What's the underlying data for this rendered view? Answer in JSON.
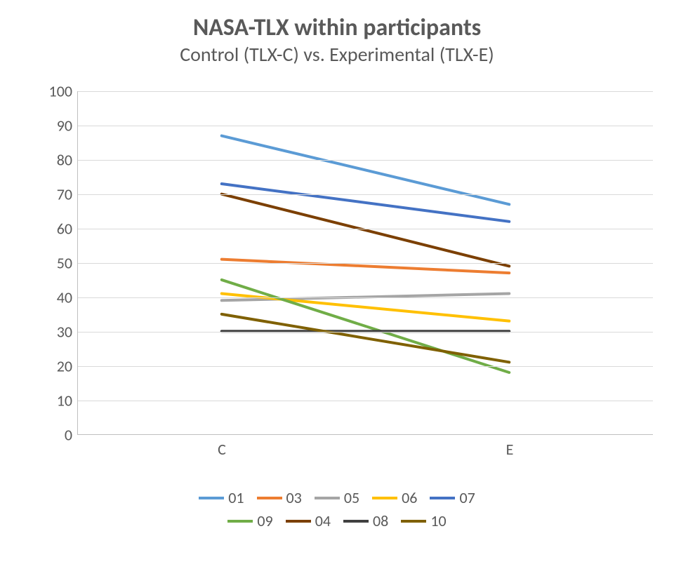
{
  "chart_data": {
    "type": "line",
    "title": "NASA-TLX within participants",
    "subtitle": "Control (TLX-C) vs. Experimental (TLX-E)",
    "xlabel": "",
    "ylabel": "",
    "categories": [
      "C",
      "E"
    ],
    "ylim": [
      0,
      100
    ],
    "yticks": [
      0,
      10,
      20,
      30,
      40,
      50,
      60,
      70,
      80,
      90,
      100
    ],
    "legend_order": [
      "01",
      "03",
      "05",
      "06",
      "07",
      "09",
      "04",
      "08",
      "10"
    ],
    "series": [
      {
        "name": "01",
        "values": [
          87,
          67
        ],
        "color": "#5B9BD5"
      },
      {
        "name": "03",
        "values": [
          51,
          47
        ],
        "color": "#ED7D31"
      },
      {
        "name": "05",
        "values": [
          39,
          41
        ],
        "color": "#A5A5A5"
      },
      {
        "name": "06",
        "values": [
          41,
          33
        ],
        "color": "#FFC000"
      },
      {
        "name": "07",
        "values": [
          73,
          62
        ],
        "color": "#4472C4"
      },
      {
        "name": "09",
        "values": [
          45,
          18
        ],
        "color": "#70AD47"
      },
      {
        "name": "04",
        "values": [
          70,
          49
        ],
        "color": "#7B3F00"
      },
      {
        "name": "08",
        "values": [
          30,
          30
        ],
        "color": "#404040"
      },
      {
        "name": "10",
        "values": [
          35,
          21
        ],
        "color": "#7F6000"
      }
    ]
  }
}
